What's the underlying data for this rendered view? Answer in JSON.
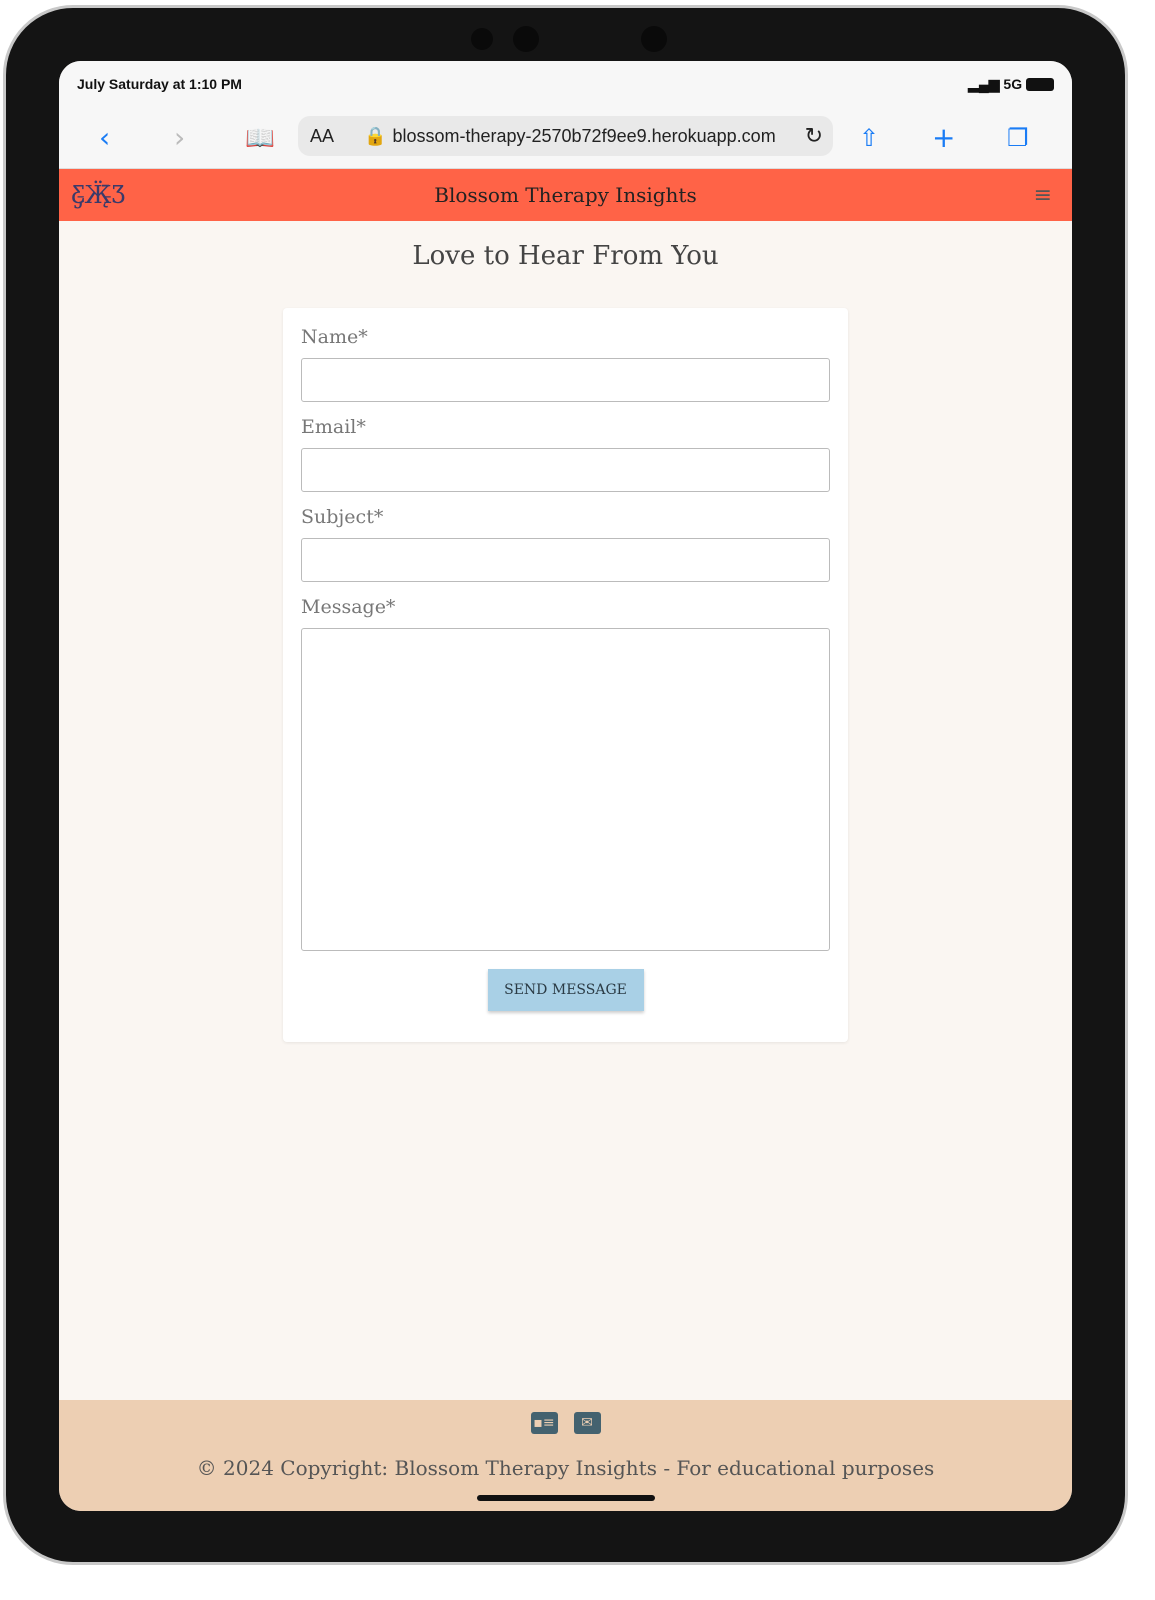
{
  "status": {
    "time": "July Saturday at 1:10 PM",
    "network": "5G"
  },
  "browser": {
    "text_size": "AA",
    "url": "blossom-therapy-2570b72f9ee9.herokuapp.com"
  },
  "nav": {
    "brand": "Blossom Therapy Insights"
  },
  "page": {
    "title": "Love to Hear From You"
  },
  "form": {
    "name_label": "Name*",
    "email_label": "Email*",
    "subject_label": "Subject*",
    "message_label": "Message*",
    "submit": "SEND MESSAGE"
  },
  "footer": {
    "copyright": "© 2024 Copyright: Blossom Therapy Insights - For educational purposes"
  },
  "colors": {
    "nav": "#ff6347",
    "footer": "#edcfb3",
    "button": "#a9d0e6",
    "icon": "#44626f"
  }
}
